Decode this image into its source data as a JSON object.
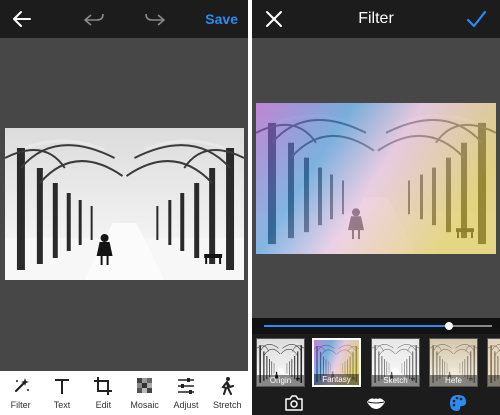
{
  "left": {
    "header": {
      "back_icon": "back-arrow-icon",
      "undo_icon": "undo-icon",
      "redo_icon": "redo-icon",
      "save_label": "Save"
    },
    "photo_icon": "snowy-park-photo",
    "toolbar": [
      {
        "label": "Filter",
        "icon": "magic-wand-icon"
      },
      {
        "label": "Text",
        "icon": "text-icon"
      },
      {
        "label": "Edit",
        "icon": "crop-icon"
      },
      {
        "label": "Mosaic",
        "icon": "mosaic-icon"
      },
      {
        "label": "Adjust",
        "icon": "sliders-icon"
      },
      {
        "label": "Stretch",
        "icon": "stretch-icon"
      }
    ]
  },
  "right": {
    "header": {
      "close_icon": "close-icon",
      "title": "Filter",
      "confirm_icon": "checkmark-icon"
    },
    "photo_icon": "snowy-park-photo-fantasy",
    "intensity": 0.81,
    "filters": [
      {
        "label": "Origin",
        "selected": false
      },
      {
        "label": "Fantasy",
        "selected": true
      },
      {
        "label": "Sketch",
        "selected": false
      },
      {
        "label": "Hefe",
        "selected": false
      },
      {
        "label": "O",
        "selected": false
      }
    ],
    "bottom_icons": [
      "camera-icon",
      "lips-icon",
      "palette-icon"
    ]
  },
  "colors": {
    "accent": "#2a8cf0",
    "topbar": "#1c1c1c",
    "canvas": "#474747"
  }
}
